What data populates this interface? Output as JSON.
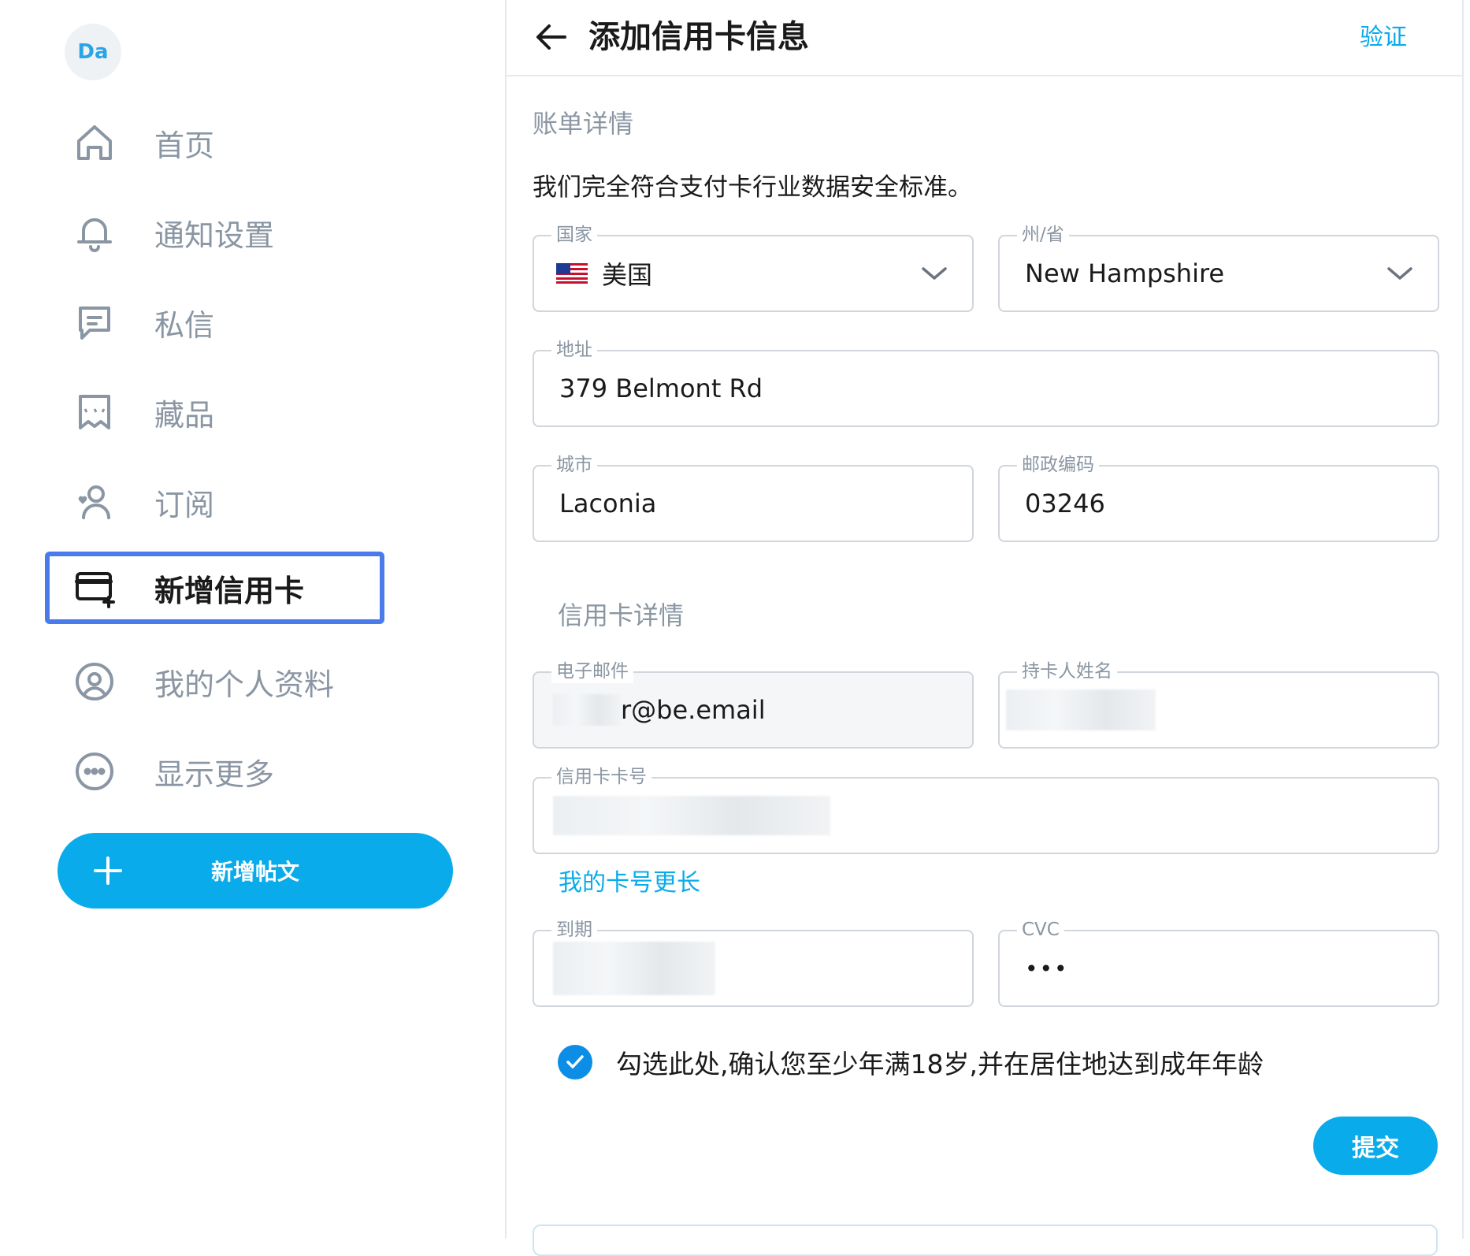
{
  "sidebar": {
    "avatar_initials": "Da",
    "items": [
      {
        "label": "首页",
        "icon": "home-icon"
      },
      {
        "label": "通知设置",
        "icon": "bell-icon"
      },
      {
        "label": "私信",
        "icon": "message-icon"
      },
      {
        "label": "藏品",
        "icon": "collection-icon"
      },
      {
        "label": "订阅",
        "icon": "subscription-icon"
      },
      {
        "label": "新增信用卡",
        "icon": "credit-card-add-icon",
        "active": true
      },
      {
        "label": "我的个人资料",
        "icon": "profile-icon"
      },
      {
        "label": "显示更多",
        "icon": "more-icon"
      }
    ],
    "new_post_label": "新增帖文"
  },
  "header": {
    "title": "添加信用卡信息",
    "verify_label": "验证"
  },
  "billing": {
    "section_title": "账单详情",
    "description": "我们完全符合支付卡行业数据安全标准。",
    "country": {
      "label": "国家",
      "value": "美国"
    },
    "state": {
      "label": "州/省",
      "value": "New Hampshire"
    },
    "address": {
      "label": "地址",
      "value": "379 Belmont Rd"
    },
    "city": {
      "label": "城市",
      "value": "Laconia"
    },
    "zip": {
      "label": "邮政编码",
      "value": "03246"
    }
  },
  "card": {
    "section_title": "信用卡详情",
    "email": {
      "label": "电子邮件",
      "value": "r@be.email"
    },
    "holder": {
      "label": "持卡人姓名",
      "value": ""
    },
    "number": {
      "label": "信用卡卡号",
      "value": ""
    },
    "longer_link": "我的卡号更长",
    "expiry": {
      "label": "到期",
      "value": ""
    },
    "cvc": {
      "label": "CVC",
      "value": "•••"
    },
    "age_confirm": "勾选此处,确认您至少年满18岁,并在居住地达到成年年龄",
    "age_checked": true,
    "submit_label": "提交"
  },
  "colors": {
    "accent": "#0aabea",
    "active_border": "#4a7bea",
    "muted_text": "#8a96a3",
    "check": "#0c8ee6"
  }
}
